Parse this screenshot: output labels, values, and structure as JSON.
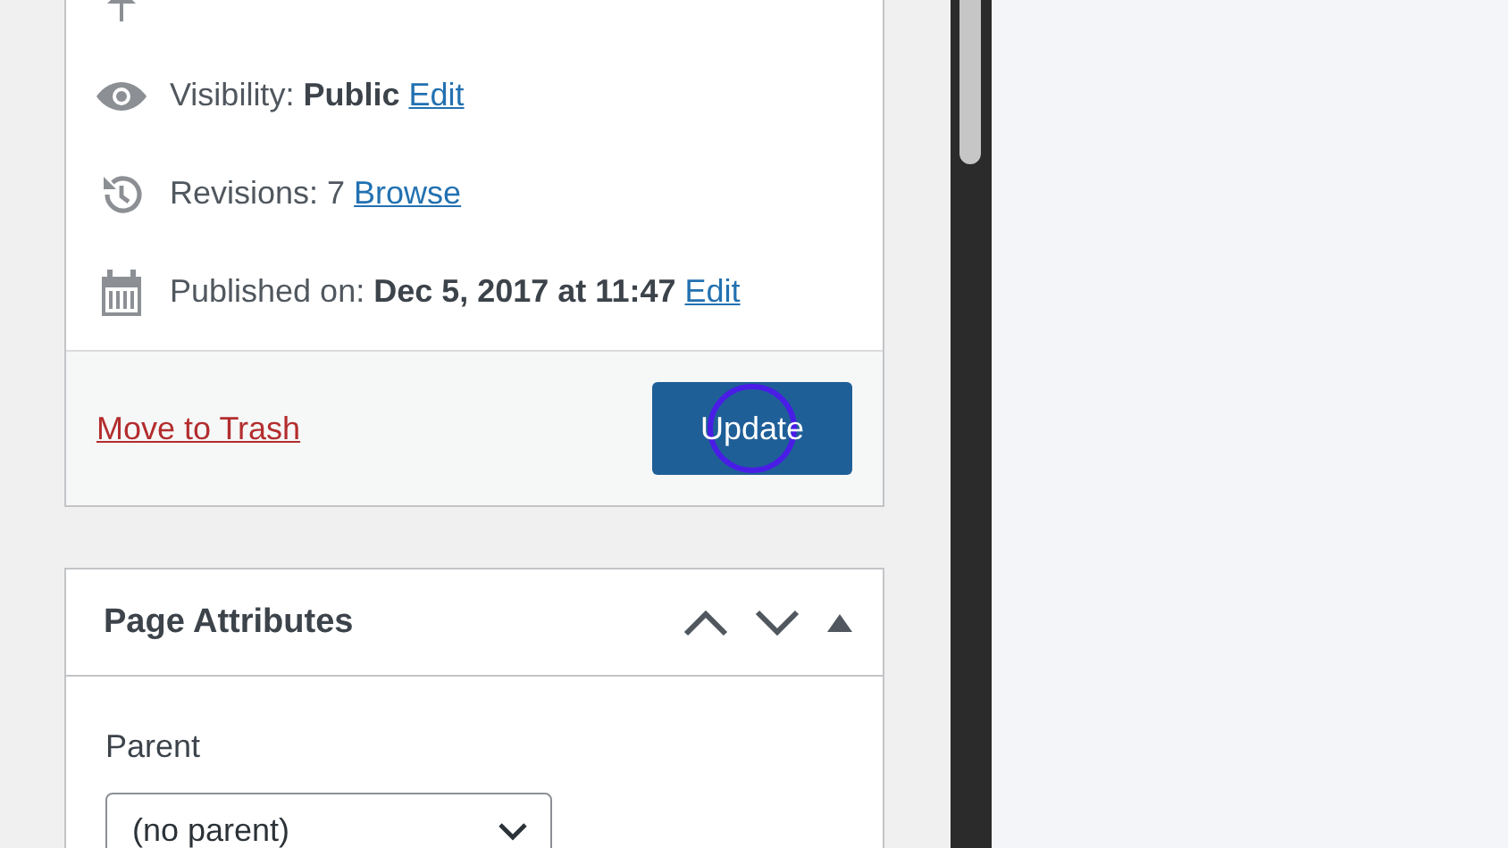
{
  "publish_box": {
    "rows": [
      {
        "kind": "status"
      },
      {
        "kind": "visibility",
        "text": "Visibility: **Public**",
        "link": "Edit"
      },
      {
        "kind": "revisions",
        "text": "Revisions: 7",
        "link": "Browse"
      },
      {
        "kind": "schedule",
        "text": "Published on: **Dec 5, 2017 at 11:47**",
        "link": "Edit"
      }
    ],
    "trash_link": "Move to Trash",
    "update_button": "Update"
  },
  "page_attributes": {
    "title": "Page Attributes",
    "parent_label": "Parent",
    "parent_select": "(no parent)"
  }
}
